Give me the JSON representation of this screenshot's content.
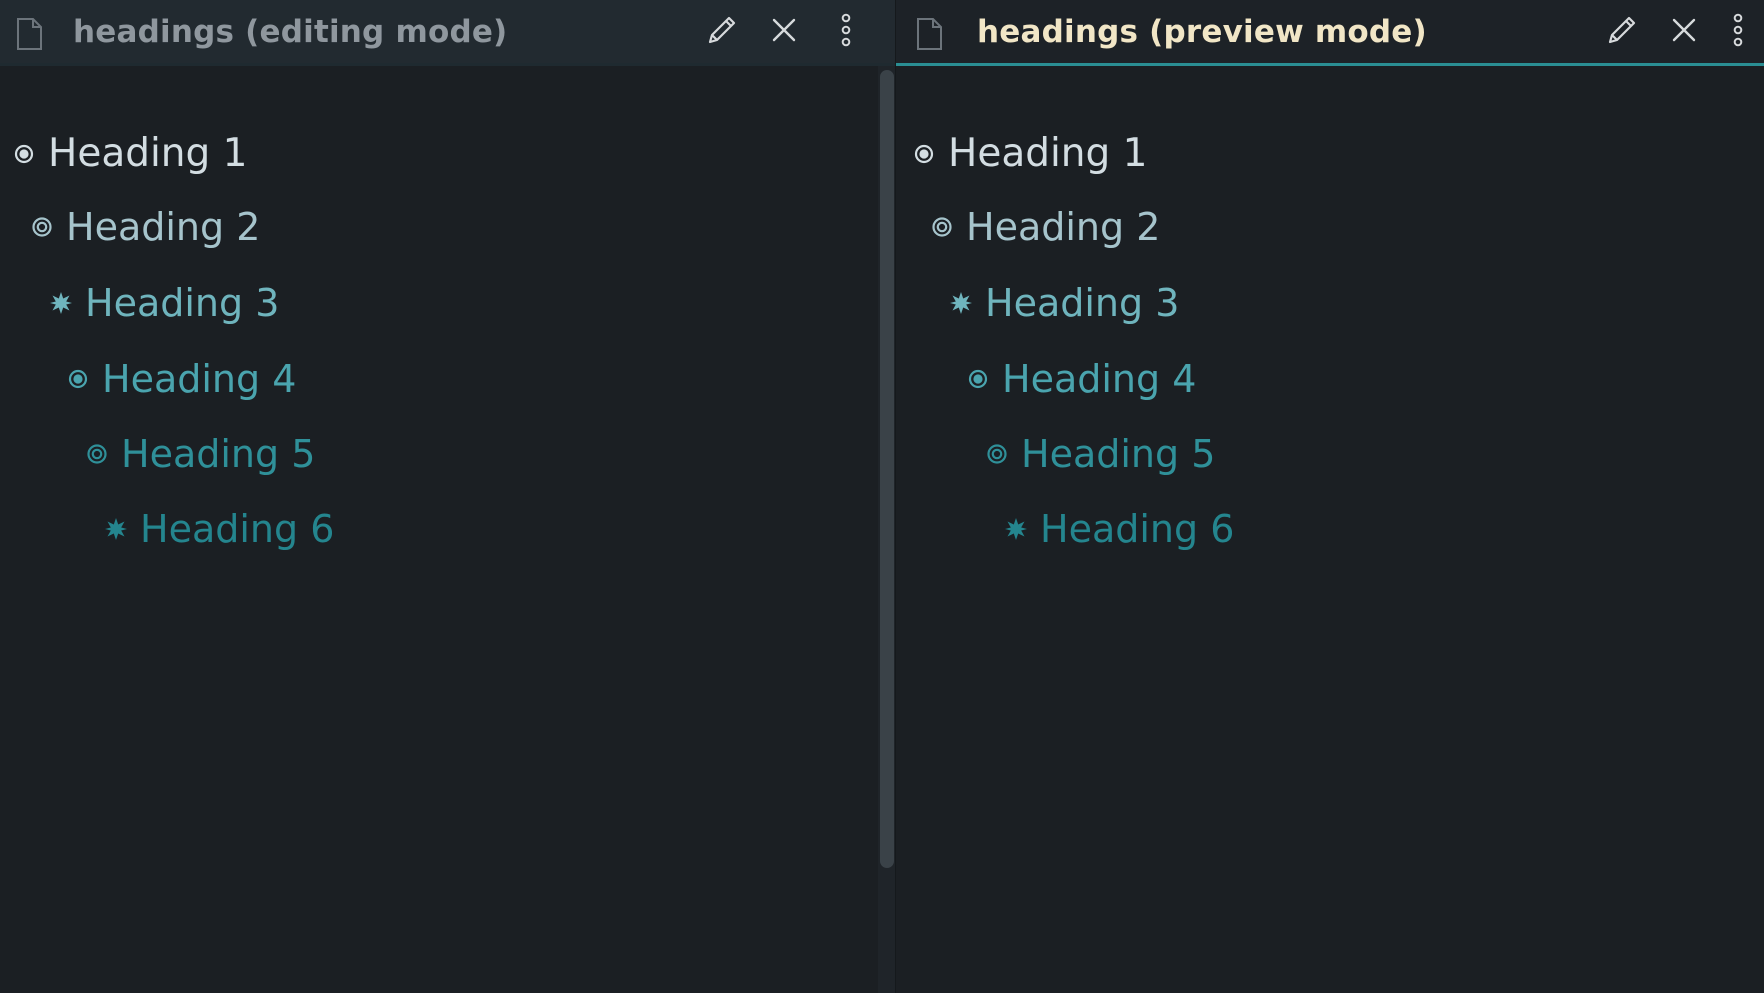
{
  "panes": [
    {
      "title": "headings (editing mode)",
      "headings": [
        {
          "text": "Heading 1",
          "bullet": "filled-circle"
        },
        {
          "text": "Heading 2",
          "bullet": "ring"
        },
        {
          "text": "Heading 3",
          "bullet": "star"
        },
        {
          "text": "Heading 4",
          "bullet": "filled-circle"
        },
        {
          "text": "Heading 5",
          "bullet": "ring"
        },
        {
          "text": "Heading 6",
          "bullet": "star"
        }
      ]
    },
    {
      "title": "headings (preview mode)",
      "headings": [
        {
          "text": "Heading 1",
          "bullet": "filled-circle"
        },
        {
          "text": "Heading 2",
          "bullet": "ring"
        },
        {
          "text": "Heading 3",
          "bullet": "star"
        },
        {
          "text": "Heading 4",
          "bullet": "filled-circle"
        },
        {
          "text": "Heading 5",
          "bullet": "ring"
        },
        {
          "text": "Heading 6",
          "bullet": "star"
        }
      ]
    }
  ],
  "header_icons": [
    "file-icon",
    "pencil-icon",
    "close-icon",
    "more-vertical-icon"
  ],
  "colors": {
    "background": "#1b1f23",
    "accent": "#2a8e93",
    "heading1": "#d3dde2",
    "heading2": "#a6c4cc",
    "heading3": "#6fb4bd",
    "heading4": "#4aa4ae",
    "heading5": "#2f9099",
    "heading6": "#24858e"
  }
}
